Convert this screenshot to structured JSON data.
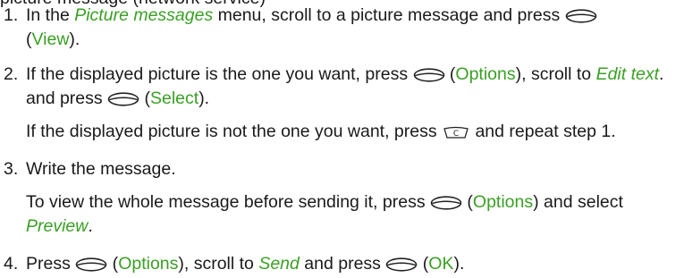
{
  "heading_fragment": "picture message (network service)",
  "green": "#3aa024",
  "s1": {
    "num": "1.",
    "a": "In the ",
    "menu": "Picture messages",
    "b": " menu, scroll to a picture message and press ",
    "c": "(",
    "view": "View",
    "d": ")."
  },
  "s2": {
    "num": "2.",
    "a": "If the displayed picture is the one you want, press ",
    "b": " (",
    "options": "Options",
    "c": "), scroll to ",
    "edit": "Edit text",
    "d": ". and press ",
    "e": " (",
    "select": "Select",
    "f": ").",
    "p2a": "If the displayed picture is not the one you want, press ",
    "p2b": " and repeat step 1."
  },
  "s3": {
    "num": "3.",
    "a": "Write the message.",
    "p2a": "To view the whole message before sending it, press ",
    "p2b": " (",
    "options": "Options",
    "p2c": ") and select ",
    "preview": "Preview",
    "p2d": "."
  },
  "s4": {
    "num": "4.",
    "a": "Press ",
    "b": " (",
    "options": "Options",
    "c": "), scroll to ",
    "send": "Send",
    "d": " and press ",
    "e": " (",
    "ok": "OK",
    "f": ")."
  },
  "icons": {
    "selection_key": "selection-key-icon",
    "clear_key": "clear-key-icon"
  }
}
